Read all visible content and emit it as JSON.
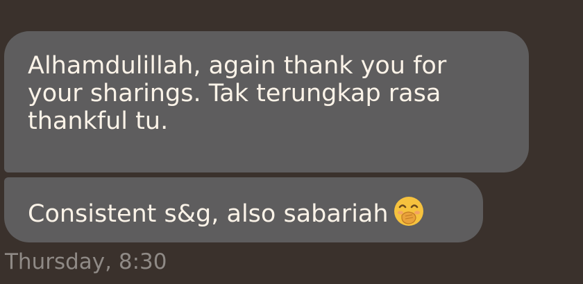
{
  "messages": [
    {
      "lines": [
        "Alhamdulillah, again thank you for",
        "your sharings. Tak terungkap rasa",
        "thankful tu."
      ]
    },
    {
      "text": "Consistent s&g, also sabariah",
      "emoji": "face-with-hand-over-mouth-icon"
    }
  ],
  "timestamp": "Thursday, 8:30",
  "colors": {
    "background": "#3a312c",
    "bubble": "#5e5d5e",
    "text": "#fbf3e8",
    "timestamp": "#8f8a86"
  }
}
